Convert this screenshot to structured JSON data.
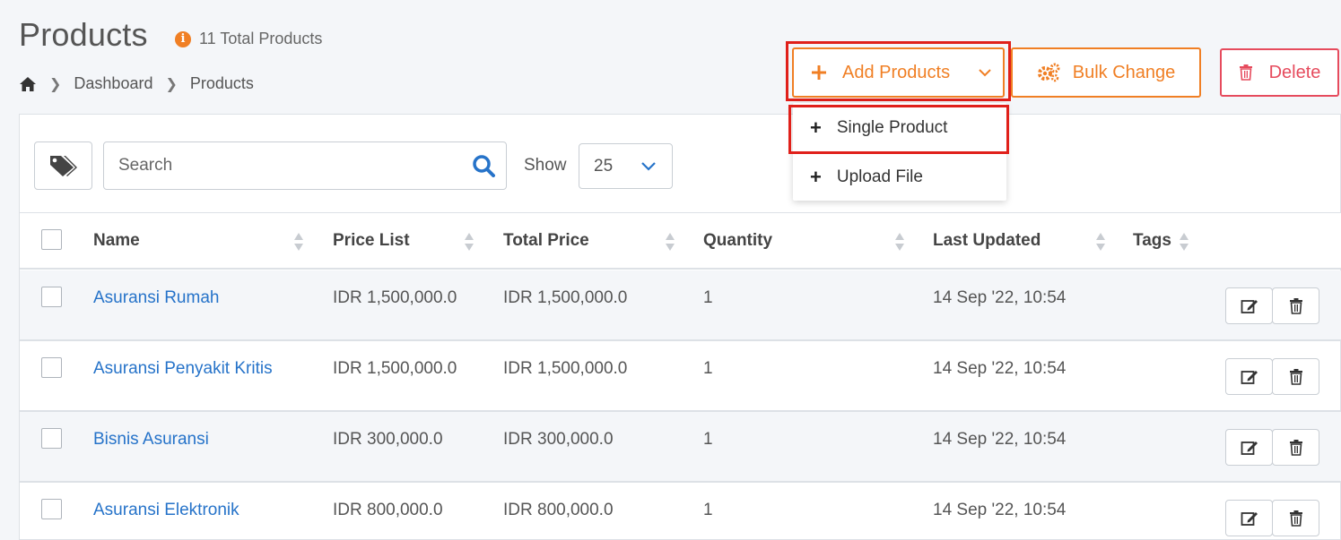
{
  "page": {
    "title": "Products",
    "total_text": "11 Total Products"
  },
  "breadcrumb": [
    "Dashboard",
    "Products"
  ],
  "actions": {
    "add_label": "Add Products",
    "bulk_label": "Bulk Change",
    "delete_label": "Delete"
  },
  "add_menu": {
    "items": [
      "Single Product",
      "Upload File"
    ]
  },
  "toolbar": {
    "search_placeholder": "Search",
    "show_label": "Show",
    "show_value": "25"
  },
  "table": {
    "columns": [
      "Name",
      "Price List",
      "Total Price",
      "Quantity",
      "Last Updated",
      "Tags"
    ],
    "rows": [
      {
        "name": "Asuransi Rumah",
        "price_list": "IDR 1,500,000.0",
        "total_price": "IDR 1,500,000.0",
        "quantity": "1",
        "last_updated": "14 Sep '22, 10:54"
      },
      {
        "name": "Asuransi Penyakit Kritis",
        "price_list": "IDR 1,500,000.0",
        "total_price": "IDR 1,500,000.0",
        "quantity": "1",
        "last_updated": "14 Sep '22, 10:54"
      },
      {
        "name": "Bisnis Asuransi",
        "price_list": "IDR 300,000.0",
        "total_price": "IDR 300,000.0",
        "quantity": "1",
        "last_updated": "14 Sep '22, 10:54"
      },
      {
        "name": "Asuransi Elektronik",
        "price_list": "IDR 800,000.0",
        "total_price": "IDR 800,000.0",
        "quantity": "1",
        "last_updated": "14 Sep '22, 10:54"
      }
    ]
  },
  "colors": {
    "accent": "#f07f24",
    "danger": "#e64b5d",
    "link": "#2673c9",
    "highlight": "#e0201a"
  },
  "icons": [
    "info-icon",
    "home-icon",
    "plus-icon",
    "chevron-down-icon",
    "gears-icon",
    "trash-icon",
    "tags-icon",
    "search-icon",
    "sort-icon",
    "edit-icon"
  ]
}
